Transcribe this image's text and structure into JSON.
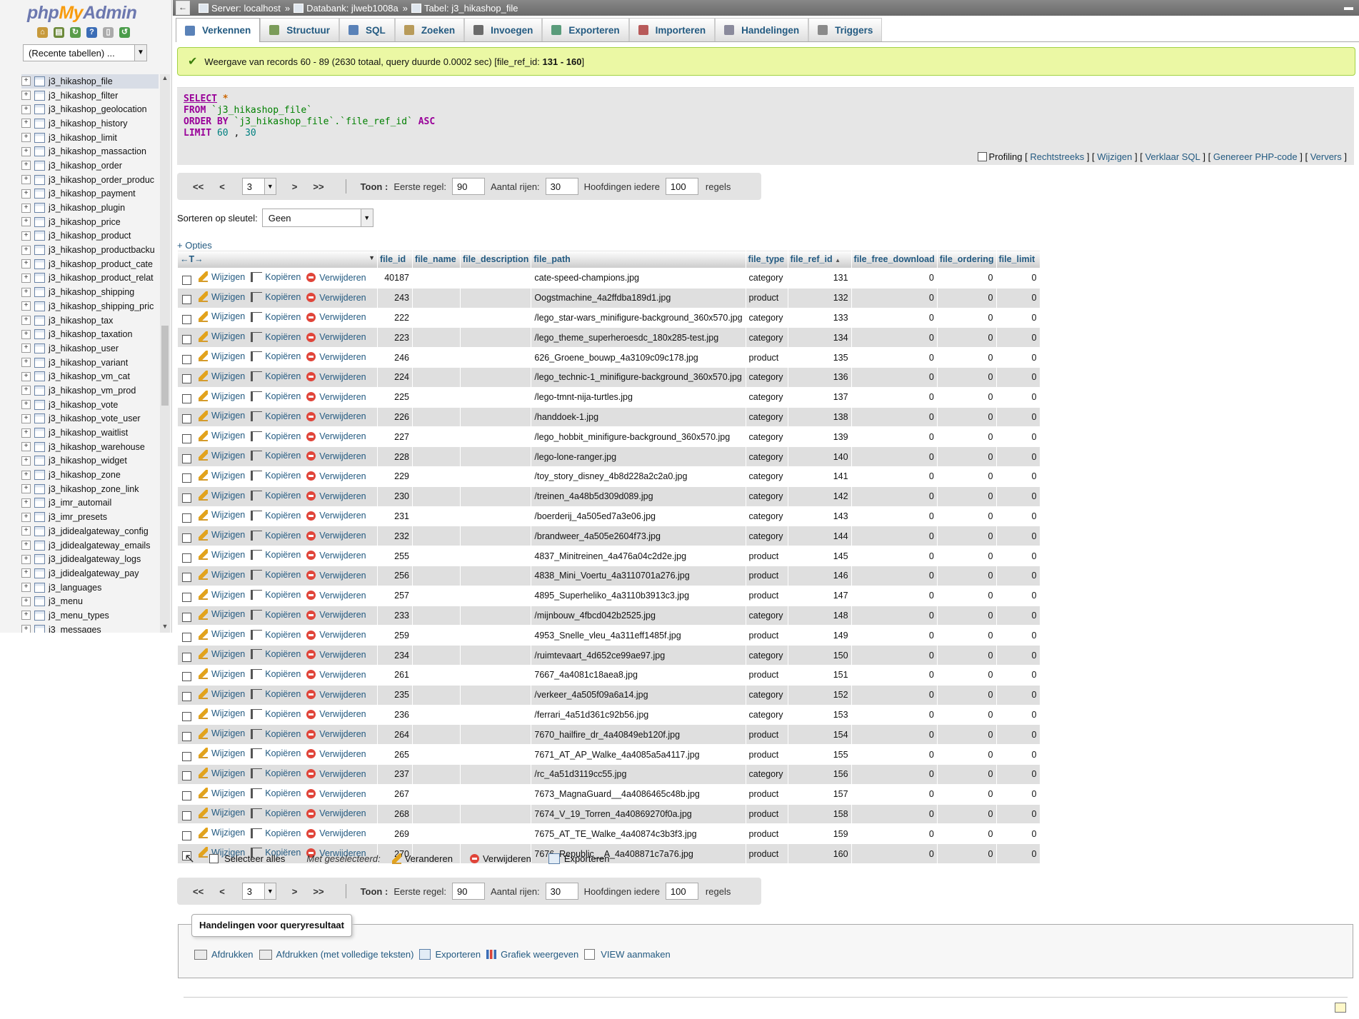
{
  "app": {
    "logo_php": "php",
    "logo_my": "My",
    "logo_admin": "Admin"
  },
  "nav": {
    "recent_tables": "(Recente tabellen) ...",
    "icons": [
      "home-icon",
      "database-icon",
      "sql-query-icon",
      "help-icon",
      "docs-icon",
      "refresh-icon"
    ],
    "tables": [
      "j3_hikashop_file",
      "j3_hikashop_filter",
      "j3_hikashop_geolocation",
      "j3_hikashop_history",
      "j3_hikashop_limit",
      "j3_hikashop_massaction",
      "j3_hikashop_order",
      "j3_hikashop_order_produc",
      "j3_hikashop_payment",
      "j3_hikashop_plugin",
      "j3_hikashop_price",
      "j3_hikashop_product",
      "j3_hikashop_productbacku",
      "j3_hikashop_product_cate",
      "j3_hikashop_product_relat",
      "j3_hikashop_shipping",
      "j3_hikashop_shipping_pric",
      "j3_hikashop_tax",
      "j3_hikashop_taxation",
      "j3_hikashop_user",
      "j3_hikashop_variant",
      "j3_hikashop_vm_cat",
      "j3_hikashop_vm_prod",
      "j3_hikashop_vote",
      "j3_hikashop_vote_user",
      "j3_hikashop_waitlist",
      "j3_hikashop_warehouse",
      "j3_hikashop_widget",
      "j3_hikashop_zone",
      "j3_hikashop_zone_link",
      "j3_imr_automail",
      "j3_imr_presets",
      "j3_jdidealgateway_config",
      "j3_jdidealgateway_emails",
      "j3_jdidealgateway_logs",
      "j3_jdidealgateway_pay",
      "j3_languages",
      "j3_menu",
      "j3_menu_types",
      "j3_messages"
    ]
  },
  "breadcrumb": {
    "server": "Server: localhost",
    "database": "Databank: jlweb1008a",
    "table": "Tabel: j3_hikashop_file",
    "sep": "»"
  },
  "tabs": [
    {
      "label": "Verkennen",
      "icon": "browse-icon",
      "color": "#5a82b8"
    },
    {
      "label": "Structuur",
      "icon": "structure-icon",
      "color": "#7b9c5a"
    },
    {
      "label": "SQL",
      "icon": "sql-icon",
      "color": "#5a82b8"
    },
    {
      "label": "Zoeken",
      "icon": "search-icon",
      "color": "#b89b5a"
    },
    {
      "label": "Invoegen",
      "icon": "insert-icon",
      "color": "#6b6b6b"
    },
    {
      "label": "Exporteren",
      "icon": "export-icon",
      "color": "#5a9c7b"
    },
    {
      "label": "Importeren",
      "icon": "import-icon",
      "color": "#b85a5a"
    },
    {
      "label": "Handelingen",
      "icon": "operations-icon",
      "color": "#8a8a9c"
    },
    {
      "label": "Triggers",
      "icon": "triggers-icon",
      "color": "#8a8a8a"
    }
  ],
  "message": {
    "text": "Weergave van records 60 - 89 (2630 totaal, query duurde 0.0002 sec) [file_ref_id:",
    "range": "131 - 160",
    "close": "]"
  },
  "sql": {
    "select": "SELECT",
    "star": "*",
    "from": "FROM",
    "from_table": "`j3_hikashop_file`",
    "order_by": "ORDER BY",
    "order_col": "`j3_hikashop_file`.`file_ref_id`",
    "asc": "ASC",
    "limit": "LIMIT",
    "limit_a": "60",
    "limit_comma": ",",
    "limit_b": "30",
    "links": {
      "profiling": "Profiling",
      "inline": "Rechtstreeks",
      "edit": "Wijzigen",
      "explain": "Verklaar SQL",
      "php": "Genereer PHP-code",
      "refresh": "Ververs"
    }
  },
  "paging": {
    "first": "<<",
    "prev": "<",
    "page": "3",
    "next": ">",
    "last": ">>",
    "show": "Toon :",
    "first_row_label": "Eerste regel:",
    "first_row": "90",
    "rows_label": "Aantal rijen:",
    "rows": "30",
    "headers_label": "Hoofdingen iedere",
    "headers_every": "100",
    "rows_suffix": "regels"
  },
  "sort": {
    "label": "Sorteren op sleutel:",
    "value": "Geen"
  },
  "options_link": "+ Opties",
  "table": {
    "columns": [
      "file_id",
      "file_name",
      "file_description",
      "file_path",
      "file_type",
      "file_ref_id",
      "file_free_download",
      "file_ordering",
      "file_limit"
    ],
    "sort_arrow": "▲",
    "nav_arrows": "←T→",
    "actions": {
      "edit": "Wijzigen",
      "copy": "Kopiëren",
      "delete": "Verwijderen"
    },
    "rows": [
      {
        "file_id": "40187",
        "file_path": "cate-speed-champions.jpg",
        "file_type": "category",
        "file_ref_id": "131"
      },
      {
        "file_id": "243",
        "file_path": "Oogstmachine_4a2ffdba189d1.jpg",
        "file_type": "product",
        "file_ref_id": "132"
      },
      {
        "file_id": "222",
        "file_path": "/lego_star-wars_minifigure-background_360x570.jpg",
        "file_type": "category",
        "file_ref_id": "133"
      },
      {
        "file_id": "223",
        "file_path": "/lego_theme_superheroesdc_180x285-test.jpg",
        "file_type": "category",
        "file_ref_id": "134"
      },
      {
        "file_id": "246",
        "file_path": "626_Groene_bouwp_4a3109c09c178.jpg",
        "file_type": "product",
        "file_ref_id": "135"
      },
      {
        "file_id": "224",
        "file_path": "/lego_technic-1_minifigure-background_360x570.jpg",
        "file_type": "category",
        "file_ref_id": "136"
      },
      {
        "file_id": "225",
        "file_path": "/lego-tmnt-nija-turtles.jpg",
        "file_type": "category",
        "file_ref_id": "137"
      },
      {
        "file_id": "226",
        "file_path": "/handdoek-1.jpg",
        "file_type": "category",
        "file_ref_id": "138"
      },
      {
        "file_id": "227",
        "file_path": "/lego_hobbit_minifigure-background_360x570.jpg",
        "file_type": "category",
        "file_ref_id": "139"
      },
      {
        "file_id": "228",
        "file_path": "/lego-lone-ranger.jpg",
        "file_type": "category",
        "file_ref_id": "140"
      },
      {
        "file_id": "229",
        "file_path": "/toy_story_disney_4b8d228a2c2a0.jpg",
        "file_type": "category",
        "file_ref_id": "141"
      },
      {
        "file_id": "230",
        "file_path": "/treinen_4a48b5d309d089.jpg",
        "file_type": "category",
        "file_ref_id": "142"
      },
      {
        "file_id": "231",
        "file_path": "/boerderij_4a505ed7a3e06.jpg",
        "file_type": "category",
        "file_ref_id": "143"
      },
      {
        "file_id": "232",
        "file_path": "/brandweer_4a505e2604f73.jpg",
        "file_type": "category",
        "file_ref_id": "144"
      },
      {
        "file_id": "255",
        "file_path": "4837_Minitreinen_4a476a04c2d2e.jpg",
        "file_type": "product",
        "file_ref_id": "145"
      },
      {
        "file_id": "256",
        "file_path": "4838_Mini_Voertu_4a3110701a276.jpg",
        "file_type": "product",
        "file_ref_id": "146"
      },
      {
        "file_id": "257",
        "file_path": "4895_Superheliko_4a3110b3913c3.jpg",
        "file_type": "product",
        "file_ref_id": "147"
      },
      {
        "file_id": "233",
        "file_path": "/mijnbouw_4fbcd042b2525.jpg",
        "file_type": "category",
        "file_ref_id": "148"
      },
      {
        "file_id": "259",
        "file_path": "4953_Snelle_vleu_4a311eff1485f.jpg",
        "file_type": "product",
        "file_ref_id": "149"
      },
      {
        "file_id": "234",
        "file_path": "/ruimtevaart_4d652ce99ae97.jpg",
        "file_type": "category",
        "file_ref_id": "150"
      },
      {
        "file_id": "261",
        "file_path": "7667_4a4081c18aea8.jpg",
        "file_type": "product",
        "file_ref_id": "151"
      },
      {
        "file_id": "235",
        "file_path": "/verkeer_4a505f09a6a14.jpg",
        "file_type": "category",
        "file_ref_id": "152"
      },
      {
        "file_id": "236",
        "file_path": "/ferrari_4a51d361c92b56.jpg",
        "file_type": "category",
        "file_ref_id": "153"
      },
      {
        "file_id": "264",
        "file_path": "7670_hailfire_dr_4a40849eb120f.jpg",
        "file_type": "product",
        "file_ref_id": "154"
      },
      {
        "file_id": "265",
        "file_path": "7671_AT_AP_Walke_4a4085a5a4117.jpg",
        "file_type": "product",
        "file_ref_id": "155"
      },
      {
        "file_id": "237",
        "file_path": "/rc_4a51d3119cc55.jpg",
        "file_type": "category",
        "file_ref_id": "156"
      },
      {
        "file_id": "267",
        "file_path": "7673_MagnaGuard__4a4086465c48b.jpg",
        "file_type": "product",
        "file_ref_id": "157"
      },
      {
        "file_id": "268",
        "file_path": "7674_V_19_Torren_4a40869270f0a.jpg",
        "file_type": "product",
        "file_ref_id": "158"
      },
      {
        "file_id": "269",
        "file_path": "7675_AT_TE_Walke_4a40874c3b3f3.jpg",
        "file_type": "product",
        "file_ref_id": "159"
      },
      {
        "file_id": "270",
        "file_path": "7676_Republic__A_4a408871c7a76.jpg",
        "file_type": "product",
        "file_ref_id": "160"
      }
    ],
    "zero": "0"
  },
  "with_selected": {
    "select_all": "Selecteer alles",
    "label": "Met geselecteerd:",
    "change": "Veranderen",
    "delete": "Verwijderen",
    "export": "Exporteren"
  },
  "query_ops": {
    "legend": "Handelingen voor queryresultaat",
    "print": "Afdrukken",
    "print_full": "Afdrukken (met volledige teksten)",
    "export": "Exporteren",
    "chart": "Grafiek weergeven",
    "view": "VIEW aanmaken"
  }
}
